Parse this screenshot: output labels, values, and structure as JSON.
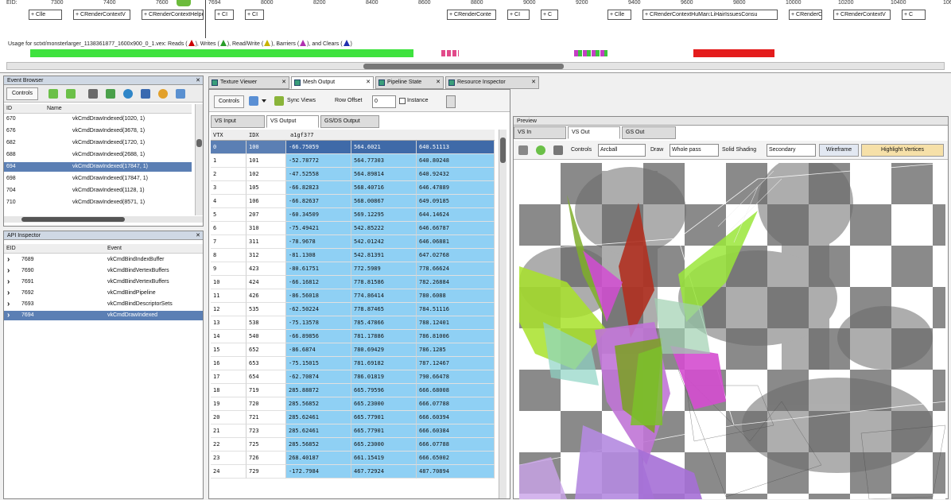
{
  "timeline": {
    "ruler": [
      "EID:",
      "7300",
      "7400",
      "7600",
      "7694",
      "8000",
      "8200",
      "8400",
      "8600",
      "8800",
      "9000",
      "9200",
      "9400",
      "9600",
      "9800",
      "10000",
      "10200",
      "10400",
      "10600"
    ],
    "markers": [
      "+ Clle",
      "+ CRenderContextV",
      "+ CRenderContextHelper",
      "+ CI",
      "+ CI",
      "+ CRenderConte",
      "+ CI",
      "+ C",
      "+ Clle",
      "+ CRenderContextHuMan:LiHairIssuesConsu",
      "+ CRenderC",
      "+ CRenderContextV",
      "+ C"
    ],
    "usage_prefix": "Usage for sctxt/monsterlarger_1138361877_1600x900_0_1.vex: Reads (",
    "usage_writes": "), Writes (",
    "usage_rw": "), Read/Write (",
    "usage_barriers": "), Barriers (",
    "usage_clears": "), and Clears (",
    "usage_end": ")"
  },
  "event_browser": {
    "title": "Event Browser",
    "controls_label": "Controls",
    "col_eid": "ID",
    "col_name": "Name",
    "rows": [
      {
        "eid": "670",
        "name": "vkCmdDrawIndexed(1020, 1)"
      },
      {
        "eid": "676",
        "name": "vkCmdDrawIndexed(3678, 1)"
      },
      {
        "eid": "682",
        "name": "vkCmdDrawIndexed(1720, 1)"
      },
      {
        "eid": "688",
        "name": "vkCmdDrawIndexed(2688, 1)"
      },
      {
        "eid": "694",
        "name": "vkCmdDrawIndexed(17847, 1)"
      },
      {
        "eid": "698",
        "name": "vkCmdDrawIndexed(17847, 1)"
      },
      {
        "eid": "704",
        "name": "vkCmdDrawIndexed(1128, 1)"
      },
      {
        "eid": "710",
        "name": "vkCmdDrawIndexed(8571, 1)"
      }
    ]
  },
  "api_inspector": {
    "title": "API Inspector",
    "col_eid": "EID",
    "col_event": "Event",
    "rows": [
      {
        "eid": "7689",
        "name": "vkCmdBindIndexBuffer"
      },
      {
        "eid": "7690",
        "name": "vkCmdBindVertexBuffers"
      },
      {
        "eid": "7691",
        "name": "vkCmdBindVertexBuffers"
      },
      {
        "eid": "7692",
        "name": "vkCmdBindPipeline"
      },
      {
        "eid": "7693",
        "name": "vkCmdBindDescriptorSets"
      },
      {
        "eid": "7694",
        "name": "vkCmdDrawIndexed"
      }
    ]
  },
  "main_tabs": [
    "Texture Viewer",
    "Mesh Output",
    "Pipeline State",
    "Resource Inspector"
  ],
  "mesh": {
    "controls_label": "Controls",
    "sync_label": "Sync Views",
    "row_offset_label": "Row Offset",
    "row_offset_value": "0",
    "instance_label": "Instance",
    "subtabs": [
      "VS Input",
      "VS Output",
      "GS/DS Output"
    ],
    "headers": [
      "VTX",
      "IDX",
      "a1gf3?7"
    ],
    "rows": [
      {
        "vtx": "0",
        "idx": "100",
        "a": "-66.75059",
        "b": "564.6021",
        "c": "640.51113"
      },
      {
        "vtx": "1",
        "idx": "101",
        "a": "-52.78772",
        "b": "564.77303",
        "c": "640.80248"
      },
      {
        "vtx": "2",
        "idx": "102",
        "a": "-47.52558",
        "b": "564.89814",
        "c": "640.92432"
      },
      {
        "vtx": "3",
        "idx": "105",
        "a": "-66.82823",
        "b": "568.40716",
        "c": "646.47889"
      },
      {
        "vtx": "4",
        "idx": "106",
        "a": "-66.82637",
        "b": "568.00867",
        "c": "649.09185"
      },
      {
        "vtx": "5",
        "idx": "207",
        "a": "-60.34509",
        "b": "569.12295",
        "c": "644.14624"
      },
      {
        "vtx": "6",
        "idx": "310",
        "a": "-75.49421",
        "b": "542.85222",
        "c": "646.66787"
      },
      {
        "vtx": "7",
        "idx": "311",
        "a": "-78.9678",
        "b": "542.01242",
        "c": "646.06881"
      },
      {
        "vtx": "8",
        "idx": "312",
        "a": "-81.1308",
        "b": "542.81391",
        "c": "647.02768"
      },
      {
        "vtx": "9",
        "idx": "423",
        "a": "-80.61751",
        "b": "772.5989",
        "c": "778.66624"
      },
      {
        "vtx": "10",
        "idx": "424",
        "a": "-66.16812",
        "b": "778.81586",
        "c": "782.26884"
      },
      {
        "vtx": "11",
        "idx": "426",
        "a": "-86.56018",
        "b": "774.86414",
        "c": "780.6088"
      },
      {
        "vtx": "12",
        "idx": "535",
        "a": "-62.50224",
        "b": "778.87465",
        "c": "784.51116"
      },
      {
        "vtx": "13",
        "idx": "538",
        "a": "-75.13578",
        "b": "785.47866",
        "c": "788.12401"
      },
      {
        "vtx": "14",
        "idx": "540",
        "a": "-66.89856",
        "b": "781.17886",
        "c": "786.81006"
      },
      {
        "vtx": "15",
        "idx": "652",
        "a": "-86.6874",
        "b": "780.69429",
        "c": "786.1285"
      },
      {
        "vtx": "16",
        "idx": "653",
        "a": "-75.15015",
        "b": "781.69182",
        "c": "787.12467"
      },
      {
        "vtx": "17",
        "idx": "654",
        "a": "-62.70874",
        "b": "786.01819",
        "c": "790.66478"
      },
      {
        "vtx": "18",
        "idx": "719",
        "a": "285.88872",
        "b": "665.79596",
        "c": "666.68008"
      },
      {
        "vtx": "19",
        "idx": "720",
        "a": "285.56852",
        "b": "665.23000",
        "c": "666.07788"
      },
      {
        "vtx": "20",
        "idx": "721",
        "a": "285.62461",
        "b": "665.77901",
        "c": "666.60394"
      },
      {
        "vtx": "21",
        "idx": "723",
        "a": "285.62461",
        "b": "665.77901",
        "c": "666.60384"
      },
      {
        "vtx": "22",
        "idx": "725",
        "a": "285.56852",
        "b": "665.23000",
        "c": "666.07788"
      },
      {
        "vtx": "23",
        "idx": "726",
        "a": "268.40187",
        "b": "661.15419",
        "c": "666.65002"
      },
      {
        "vtx": "24",
        "idx": "729",
        "a": "-172.7984",
        "b": "467.72924",
        "c": "487.70894"
      }
    ]
  },
  "preview": {
    "title": "Preview",
    "tabs": [
      "VS In",
      "VS Out",
      "GS Out"
    ],
    "controls_label": "Controls",
    "camera_value": "Arcball",
    "draw_label": "Draw",
    "draw_value": "Whole pass",
    "shading_label": "Solid Shading",
    "shading_value": "Secondary",
    "wireframe_label": "Wireframe",
    "highlight_label": "Highlight Vertices"
  },
  "colors": {
    "selection": "#5b7fb4",
    "cell_blue": "#8fd0f4",
    "timeline_green": "#3ee23e",
    "timeline_red": "#e41c1c"
  }
}
